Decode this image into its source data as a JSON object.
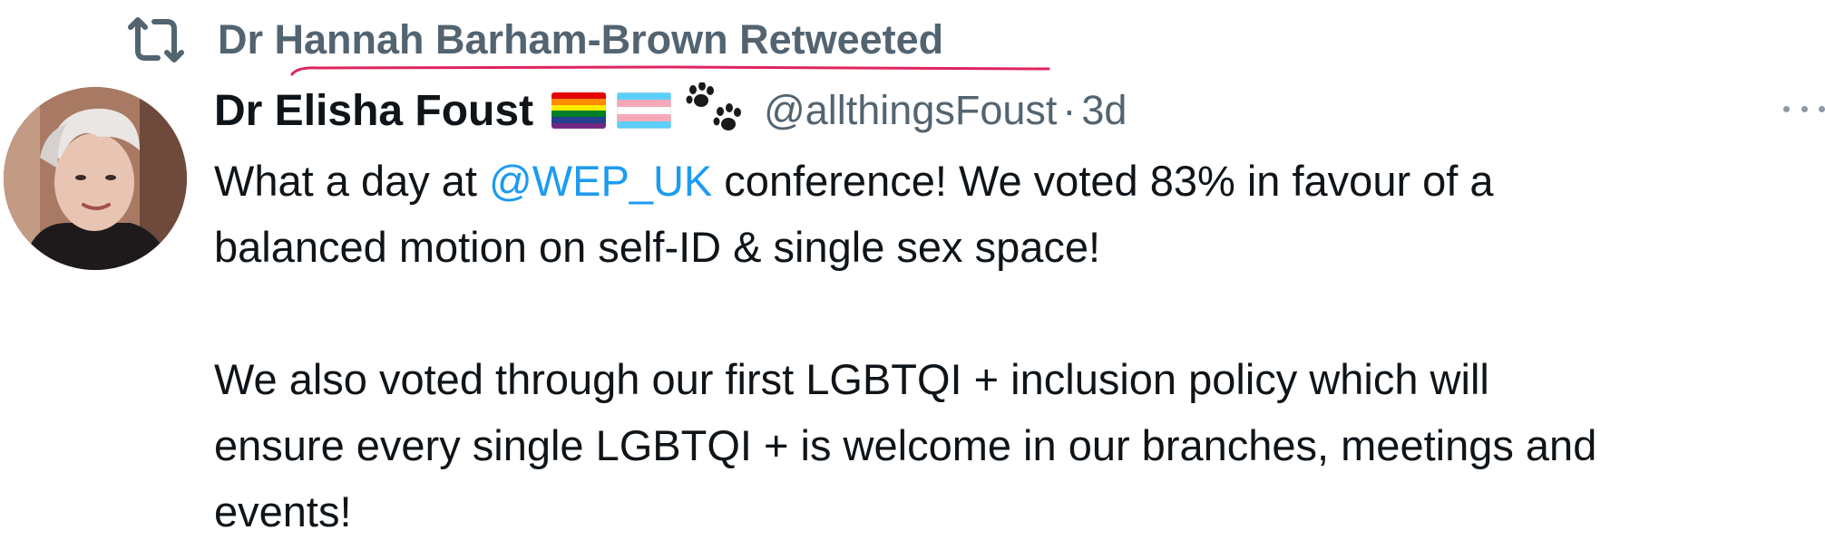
{
  "retweet": {
    "label": "Dr Hannah Barham-Brown Retweeted",
    "icon": "retweet-icon"
  },
  "author": {
    "display_name": "Dr Elisha Foust",
    "badges": [
      "rainbow-flag",
      "transgender-flag",
      "paw-prints"
    ],
    "handle": "@allthingsFoust",
    "separator": "·",
    "timestamp": "3d"
  },
  "more_icon": "more-horizontal-icon",
  "body": {
    "line1_before": "What a day at ",
    "mention": "@WEP_UK",
    "line1_after": " conference!  We voted 83% in favour of a",
    "line2": "balanced motion on self-ID & single sex space!",
    "line3": "We also voted through our first LGBTQI + inclusion policy which will",
    "line4": "ensure every single LGBTQI + is welcome in our branches, meetings and",
    "line5": "events!"
  },
  "colors": {
    "text": "#0f1419",
    "muted": "#536471",
    "link": "#1d9bf0",
    "annotation_underline": "#e0245e"
  }
}
